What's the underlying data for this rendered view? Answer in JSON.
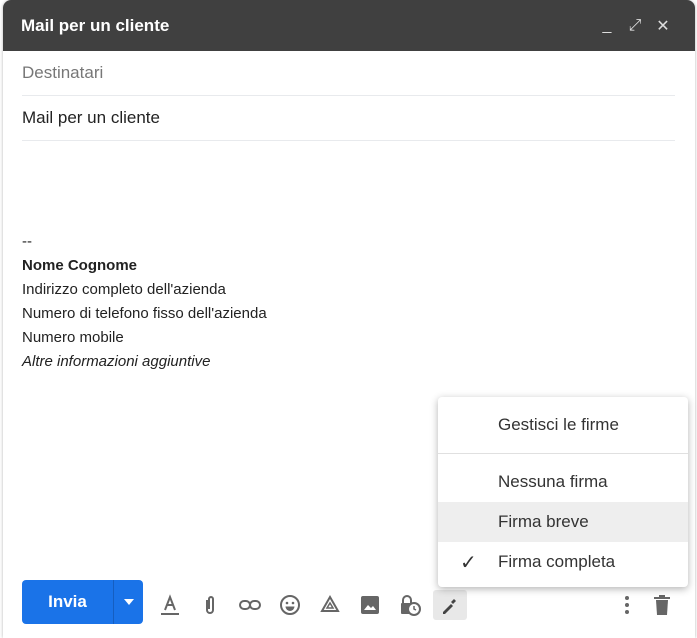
{
  "header": {
    "title": "Mail per un cliente",
    "minimize": "_",
    "expand": "⤢",
    "close": "✕"
  },
  "to_placeholder": "Destinatari",
  "subject": "Mail per un cliente",
  "signature": {
    "sep": "--",
    "name": "Nome Cognome",
    "address": "Indirizzo completo dell'azienda",
    "phone": "Numero di telefono fisso dell'azienda",
    "mobile": "Numero mobile",
    "extra": "Altre informazioni aggiuntive"
  },
  "menu": {
    "manage": "Gestisci le firme",
    "items": [
      {
        "label": "Nessuna firma"
      },
      {
        "label": "Firma breve"
      },
      {
        "label": "Firma completa",
        "checked": true
      }
    ],
    "check": "✓"
  },
  "toolbar": {
    "send": "Invia"
  },
  "colors": {
    "accent": "#1a73e8",
    "header": "#404040"
  }
}
